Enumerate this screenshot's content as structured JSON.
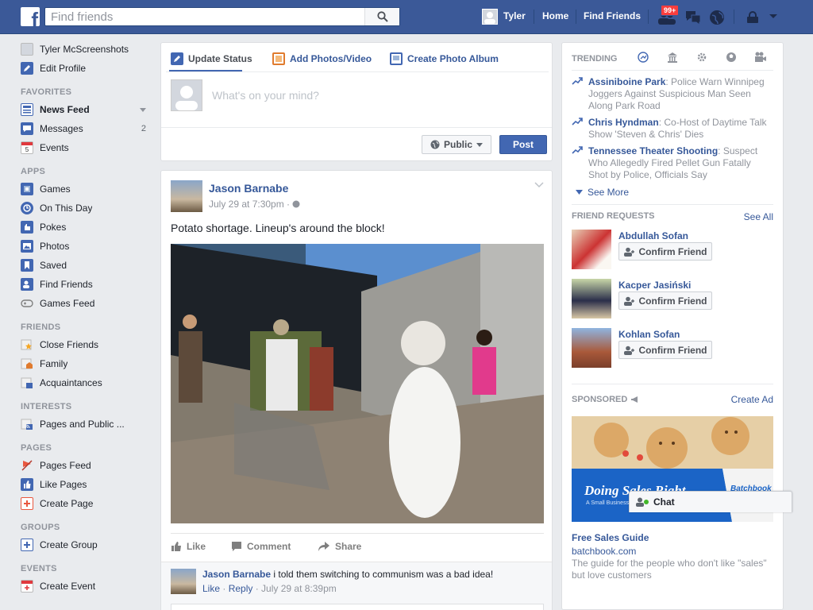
{
  "topbar": {
    "search_placeholder": "Find friends",
    "user_name": "Tyler",
    "home_label": "Home",
    "find_friends_label": "Find Friends",
    "friend_requests_badge": "99+"
  },
  "leftnav": {
    "profile_name": "Tyler McScreenshots",
    "edit_profile": "Edit Profile",
    "favorites_heading": "FAVORITES",
    "favorites": [
      {
        "label": "News Feed",
        "icon": "newsfeed-icon"
      },
      {
        "label": "Messages",
        "icon": "messages-icon",
        "count": "2"
      },
      {
        "label": "Events",
        "icon": "events-icon"
      }
    ],
    "apps_heading": "APPS",
    "apps": [
      {
        "label": "Games",
        "icon": "games-icon"
      },
      {
        "label": "On This Day",
        "icon": "on-this-day-icon"
      },
      {
        "label": "Pokes",
        "icon": "pokes-icon"
      },
      {
        "label": "Photos",
        "icon": "photos-icon"
      },
      {
        "label": "Saved",
        "icon": "saved-icon"
      },
      {
        "label": "Find Friends",
        "icon": "find-friends-icon"
      },
      {
        "label": "Games Feed",
        "icon": "games-feed-icon"
      }
    ],
    "friends_heading": "FRIENDS",
    "friends": [
      {
        "label": "Close Friends",
        "icon": "close-friends-icon"
      },
      {
        "label": "Family",
        "icon": "family-icon"
      },
      {
        "label": "Acquaintances",
        "icon": "acquaintances-icon"
      }
    ],
    "interests_heading": "INTERESTS",
    "interests": [
      {
        "label": "Pages and Public ...",
        "icon": "pages-public-icon"
      }
    ],
    "pages_heading": "PAGES",
    "pages": [
      {
        "label": "Pages Feed",
        "icon": "pages-feed-icon"
      },
      {
        "label": "Like Pages",
        "icon": "like-pages-icon"
      },
      {
        "label": "Create Page",
        "icon": "create-page-icon"
      }
    ],
    "groups_heading": "GROUPS",
    "groups": [
      {
        "label": "Create Group",
        "icon": "create-group-icon"
      }
    ],
    "events_heading": "EVENTS",
    "events": [
      {
        "label": "Create Event",
        "icon": "create-event-icon"
      }
    ]
  },
  "composer": {
    "tab_status": "Update Status",
    "tab_photos": "Add Photos/Video",
    "tab_album": "Create Photo Album",
    "placeholder": "What's on your mind?",
    "privacy": "Public",
    "post_button": "Post"
  },
  "post": {
    "author": "Jason Barnabe",
    "time": "July 29 at 7:30pm · ",
    "text": "Potato shortage. Lineup's around the block!",
    "like": "Like",
    "comment": "Comment",
    "share": "Share",
    "comment_author": "Jason Barnabe",
    "comment_text": " i told them switching to communism was a bad idea!",
    "comment_like": "Like",
    "comment_reply": "Reply",
    "comment_time": " · July 29 at 8:39pm"
  },
  "trending": {
    "heading": "TRENDING",
    "items": [
      {
        "topic": "Assiniboine Park",
        "desc": ": Police Warn Winnipeg Joggers Against Suspicious Man Seen Along Park Road"
      },
      {
        "topic": "Chris Hyndman",
        "desc": ": Co-Host of Daytime Talk Show 'Steven & Chris' Dies"
      },
      {
        "topic": "Tennessee Theater Shooting",
        "desc": ": Suspect Who Allegedly Fired Pellet Gun Fatally Shot by Police, Officials Say"
      }
    ],
    "see_more": "See More"
  },
  "friend_requests": {
    "heading": "FRIEND REQUESTS",
    "see_all": "See All",
    "confirm_label": "Confirm Friend",
    "people": [
      {
        "name": "Abdullah Sofan"
      },
      {
        "name": "Kacper Jasiński"
      },
      {
        "name": "Kohlan Sofan"
      }
    ]
  },
  "sponsored": {
    "heading": "SPONSORED",
    "create_ad": "Create Ad",
    "ad_banner_text": "Doing Sales Right",
    "ad_banner_sub": "A Small Business",
    "ad_brand": "Batchbook",
    "title": "Free Sales Guide",
    "domain": "batchbook.com",
    "description": "The guide for the people who don't like \"sales\" but love customers"
  },
  "chat": {
    "label": "Chat"
  },
  "colors": {
    "brand_blue": "#3b5998",
    "link_blue": "#365899",
    "badge_red": "#fa3e3e"
  }
}
